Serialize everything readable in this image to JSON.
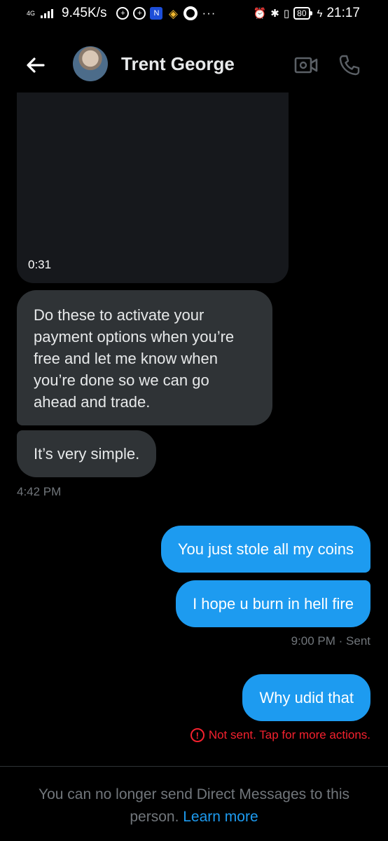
{
  "status_bar": {
    "network": "4G",
    "speed": "9.45K/s",
    "more": "···",
    "battery": "80",
    "time": "21:17"
  },
  "header": {
    "title": "Trent George"
  },
  "messages": {
    "video_duration": "0:31",
    "received_1": "Do these to activate your payment options when you’re free and let me know when you’re done so we can go ahead and trade.",
    "received_2": "It’s very simple.",
    "received_time": "4:42 PM",
    "sent_1": "You just stole all my coins",
    "sent_2": "I hope u burn in hell fire",
    "sent_time": "9:00 PM · Sent",
    "sent_3": "Why udid that",
    "error_text": "Not sent. Tap for more actions."
  },
  "footer": {
    "notice_text": "You can no longer send Direct Messages to this person.",
    "learn_more": "Learn more"
  },
  "colors": {
    "accent": "#1d9bf0",
    "error": "#f4212e",
    "received_bubble": "#2f3336",
    "muted": "#71767b"
  }
}
